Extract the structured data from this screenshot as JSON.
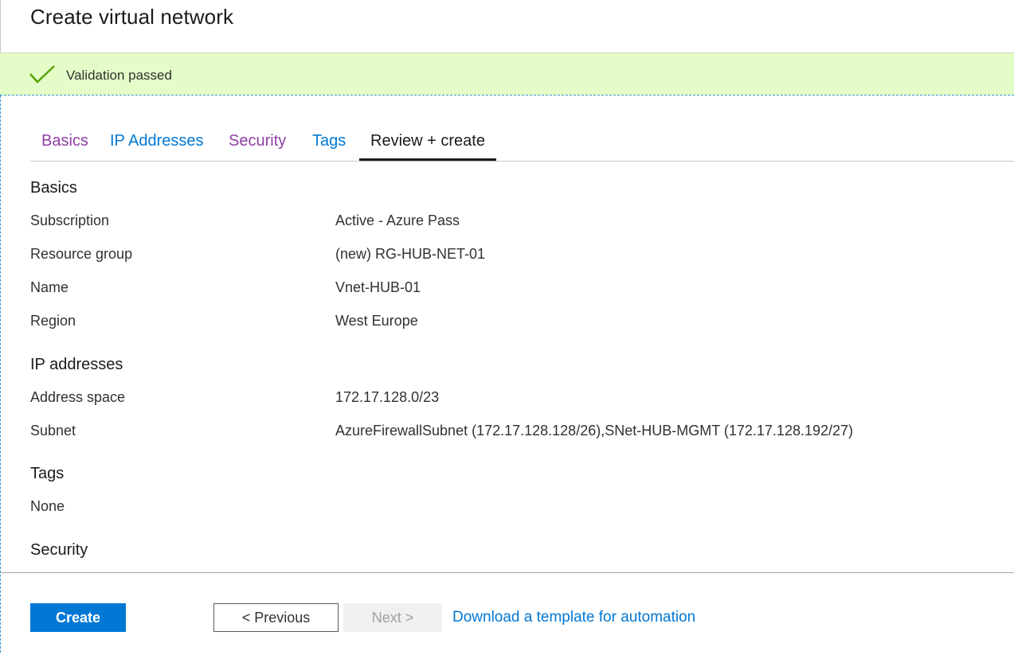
{
  "header": {
    "title": "Create virtual network"
  },
  "banner": {
    "message": "Validation passed",
    "icon": "checkmark-icon"
  },
  "tabs": [
    {
      "label": "Basics",
      "state": "visited"
    },
    {
      "label": "IP Addresses",
      "state": "link"
    },
    {
      "label": "Security",
      "state": "visited"
    },
    {
      "label": "Tags",
      "state": "link"
    },
    {
      "label": "Review + create",
      "state": "active"
    }
  ],
  "review": {
    "basics": {
      "heading": "Basics",
      "rows": [
        {
          "label": "Subscription",
          "value": "Active - Azure Pass"
        },
        {
          "label": "Resource group",
          "value": "(new) RG-HUB-NET-01"
        },
        {
          "label": "Name",
          "value": "Vnet-HUB-01"
        },
        {
          "label": "Region",
          "value": "West Europe"
        }
      ]
    },
    "ip": {
      "heading": "IP addresses",
      "rows": [
        {
          "label": "Address space",
          "value": "172.17.128.0/23"
        },
        {
          "label": "Subnet",
          "value": "AzureFirewallSubnet (172.17.128.128/26),SNet-HUB-MGMT (172.17.128.192/27)"
        }
      ]
    },
    "tags": {
      "heading": "Tags",
      "value": "None"
    },
    "security": {
      "heading": "Security"
    }
  },
  "footer": {
    "create_label": "Create",
    "previous_label": "< Previous",
    "next_label": "Next >",
    "download_label": "Download a template for automation"
  },
  "colors": {
    "accent": "#0078d4",
    "banner_bg": "#e4fdc8",
    "check": "#57a300",
    "visited": "#8e3ea5"
  }
}
